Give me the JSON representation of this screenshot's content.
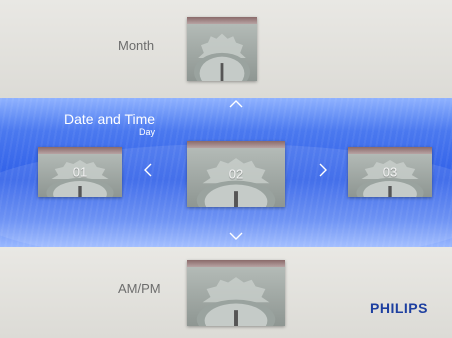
{
  "rows": {
    "top": {
      "label": "Month"
    },
    "middle": {
      "title": "Date and Time",
      "sublabel": "Day",
      "prev_value": "01",
      "current_value": "02",
      "next_value": "03"
    },
    "bottom": {
      "label": "AM/PM"
    }
  },
  "brand": "PHILIPS",
  "icons": {
    "up": "chevron-up-icon",
    "down": "chevron-down-icon",
    "left": "chevron-left-icon",
    "right": "chevron-right-icon"
  },
  "colors": {
    "highlight_blue": "#3a66ea",
    "brand_blue": "#1d3fa0",
    "background": "#e3e2dd"
  }
}
